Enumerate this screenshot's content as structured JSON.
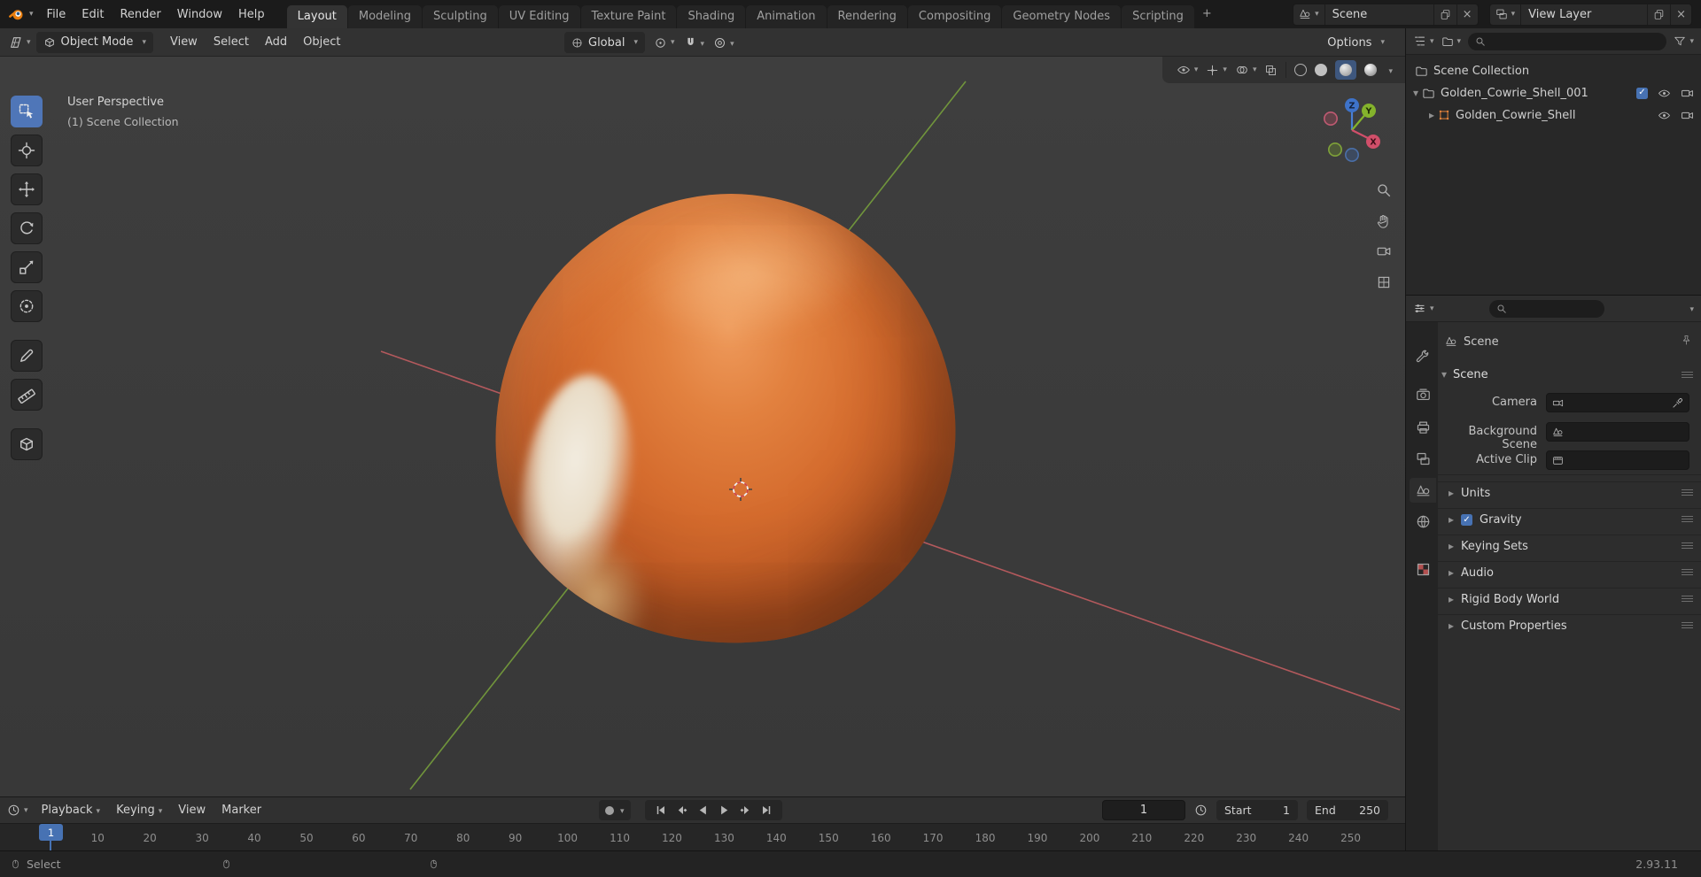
{
  "theme": {
    "accent": "#4772b3",
    "object_orange": "#e8853c",
    "axis_x_color": "#c95f63",
    "axis_y_color": "#7aa53c"
  },
  "topbar": {
    "menus": [
      "File",
      "Edit",
      "Render",
      "Window",
      "Help"
    ],
    "tabs": [
      {
        "label": "Layout",
        "active": true
      },
      {
        "label": "Modeling",
        "active": false
      },
      {
        "label": "Sculpting",
        "active": false
      },
      {
        "label": "UV Editing",
        "active": false
      },
      {
        "label": "Texture Paint",
        "active": false
      },
      {
        "label": "Shading",
        "active": false
      },
      {
        "label": "Animation",
        "active": false
      },
      {
        "label": "Rendering",
        "active": false
      },
      {
        "label": "Compositing",
        "active": false
      },
      {
        "label": "Geometry Nodes",
        "active": false
      },
      {
        "label": "Scripting",
        "active": false
      }
    ],
    "new_tab_label": "+",
    "scene_name": "Scene",
    "view_layer_name": "View Layer"
  },
  "viewport_header": {
    "mode": "Object Mode",
    "menus": [
      "View",
      "Select",
      "Add",
      "Object"
    ],
    "orientation": "Global",
    "options_label": "Options"
  },
  "viewport": {
    "overlay": {
      "line1": "User Perspective",
      "line2": "(1) Scene Collection"
    },
    "gizmo": {
      "x_label": "X",
      "y_label": "Y",
      "z_label": "Z"
    },
    "shading_modes": [
      "wireframe",
      "solid",
      "material-preview",
      "rendered"
    ],
    "active_shading": "material-preview"
  },
  "toolbar": {
    "tools": [
      {
        "name": "tweak-select",
        "active": true
      },
      {
        "name": "cursor",
        "active": false
      },
      {
        "name": "move",
        "active": false
      },
      {
        "name": "rotate",
        "active": false
      },
      {
        "name": "scale",
        "active": false
      },
      {
        "name": "transform",
        "active": false
      },
      {
        "name": "annotate",
        "active": false
      },
      {
        "name": "measure",
        "active": false
      },
      {
        "name": "add-cube",
        "active": false
      }
    ]
  },
  "outliner": {
    "rows": [
      {
        "label": "Scene Collection",
        "icon": "collection",
        "depth": 0,
        "toggles": []
      },
      {
        "label": "Golden_Cowrie_Shell_001",
        "icon": "collection",
        "depth": 0,
        "expanded": true,
        "toggles": [
          "checkbox",
          "eye",
          "camera"
        ]
      },
      {
        "label": "Golden_Cowrie_Shell",
        "icon": "object",
        "depth": 1,
        "expanded": false,
        "toggles": [
          "eye",
          "camera"
        ]
      }
    ]
  },
  "properties": {
    "breadcrumb": "Scene",
    "panel_title": "Scene",
    "fields": [
      {
        "label": "Camera",
        "icon": "camera",
        "eyedropper": true
      },
      {
        "label": "Background Scene",
        "icon": "scene",
        "eyedropper": false
      },
      {
        "label": "Active Clip",
        "icon": "movie-clip",
        "eyedropper": false
      }
    ],
    "sections": [
      {
        "label": "Units"
      },
      {
        "label": "Gravity",
        "checkbox": true,
        "checked": true
      },
      {
        "label": "Keying Sets"
      },
      {
        "label": "Audio"
      },
      {
        "label": "Rigid Body World"
      },
      {
        "label": "Custom Properties"
      }
    ],
    "tabs": [
      {
        "name": "tool",
        "active": false
      },
      {
        "name": "render",
        "active": false
      },
      {
        "name": "output",
        "active": false
      },
      {
        "name": "view-layer",
        "active": false
      },
      {
        "name": "scene",
        "active": true
      },
      {
        "name": "world",
        "active": false
      },
      {
        "name": "texture",
        "active": false
      }
    ]
  },
  "timeline": {
    "menus": [
      {
        "label": "Playback",
        "caret": true
      },
      {
        "label": "Keying",
        "caret": true
      },
      {
        "label": "View",
        "caret": false
      },
      {
        "label": "Marker",
        "caret": false
      }
    ],
    "current_frame": "1",
    "start_label": "Start",
    "start_value": "1",
    "end_label": "End",
    "end_value": "250",
    "ruler_labels": [
      "10",
      "20",
      "30",
      "40",
      "50",
      "60",
      "70",
      "80",
      "90",
      "100",
      "110",
      "120",
      "130",
      "140",
      "150",
      "160",
      "170",
      "180",
      "190",
      "200",
      "210",
      "220",
      "230",
      "240",
      "250"
    ]
  },
  "statusbar": {
    "select_label": "Select",
    "version": "2.93.11"
  }
}
